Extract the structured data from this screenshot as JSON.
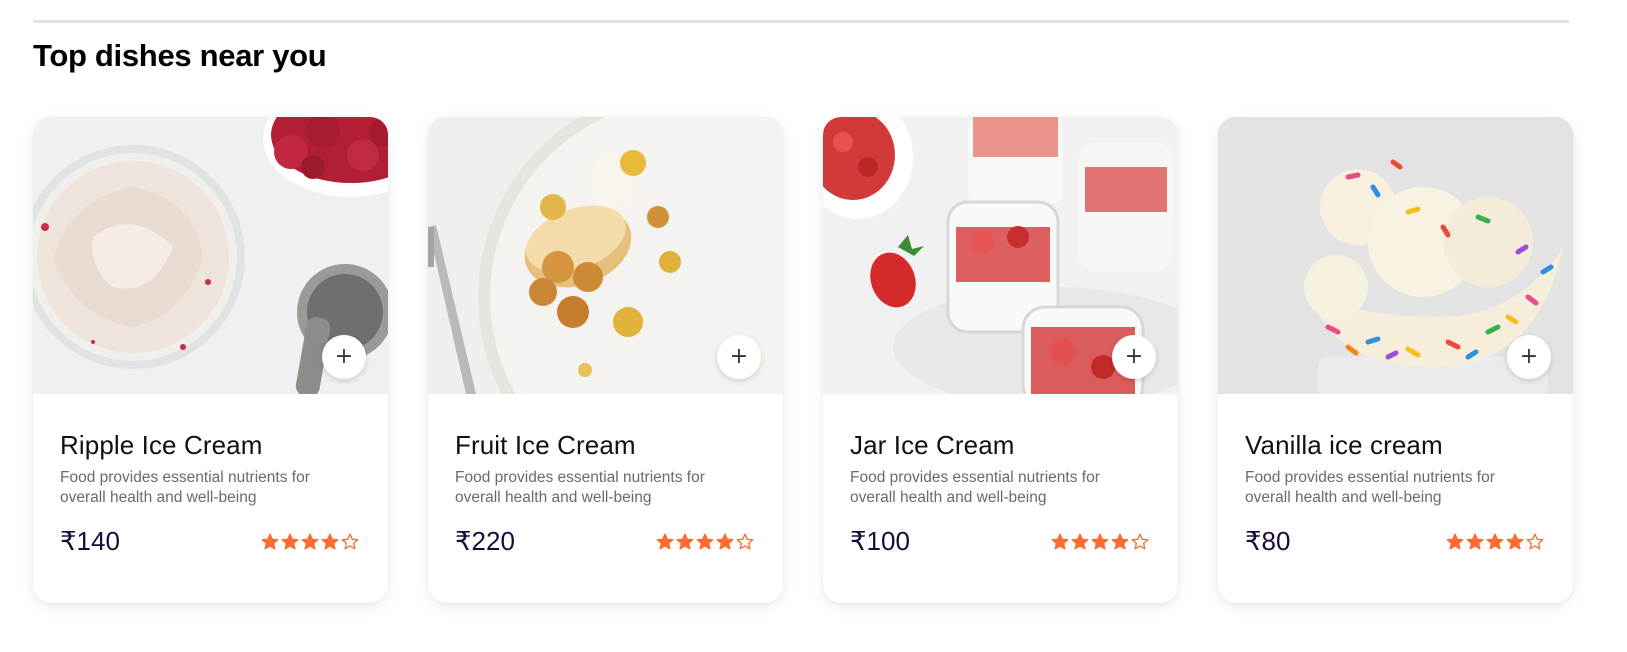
{
  "section": {
    "title": "Top dishes near you"
  },
  "colors": {
    "star": "#ff6a33",
    "price": "#1b0a3a",
    "divider": "#e2e2e2"
  },
  "dishes": [
    {
      "name": "Ripple Ice Cream",
      "description": "Food provides essential nutrients for overall health and well-being",
      "price": "₹140",
      "rating": 4,
      "max_rating": 5,
      "add_label": "+",
      "image": "ripple-ice-cream-bowl-with-raspberries"
    },
    {
      "name": "Fruit Ice Cream",
      "description": "Food provides essential nutrients for overall health and well-being",
      "price": "₹220",
      "rating": 4,
      "max_rating": 5,
      "add_label": "+",
      "image": "plated-dessert-with-ice-cream-scoop"
    },
    {
      "name": "Jar Ice Cream",
      "description": "Food provides essential nutrients for overall health and well-being",
      "price": "₹100",
      "rating": 4,
      "max_rating": 5,
      "add_label": "+",
      "image": "panna-cotta-jars-with-strawberries"
    },
    {
      "name": "Vanilla ice cream",
      "description": "Food provides essential nutrients for overall health and well-being",
      "price": "₹80",
      "rating": 4,
      "max_rating": 5,
      "add_label": "+",
      "image": "vanilla-scoops-in-sprinkle-bowl"
    }
  ]
}
